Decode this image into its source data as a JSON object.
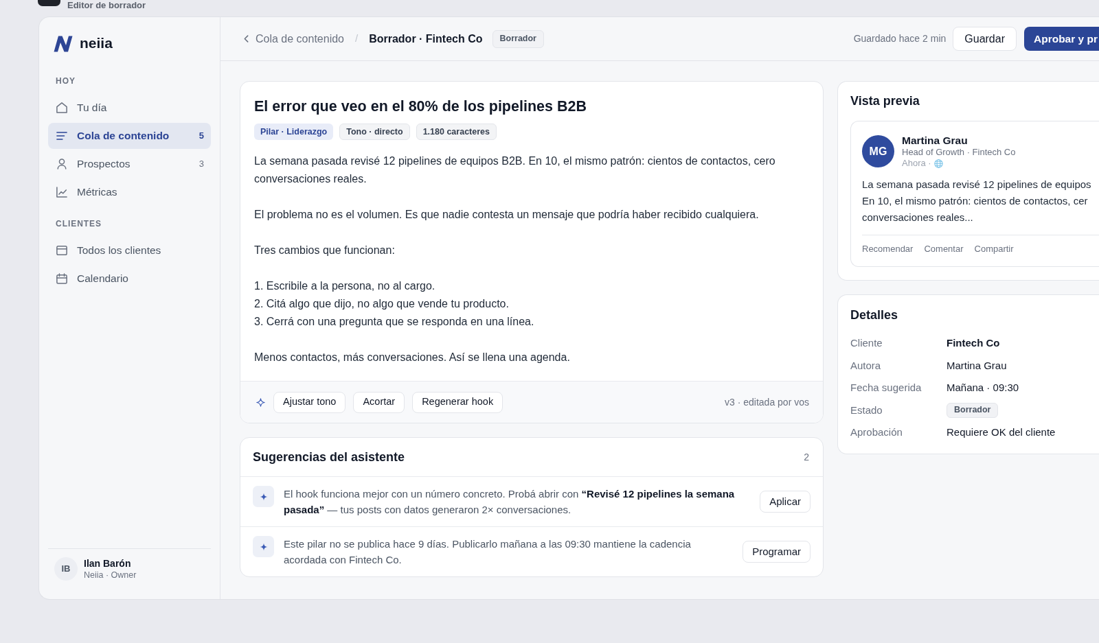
{
  "top_bar": {
    "title": "Editor de borrador"
  },
  "sidebar": {
    "logo": "neiia",
    "sections": [
      {
        "heading": "HOY",
        "items": [
          {
            "label": "Tu día",
            "selected": false
          },
          {
            "label": "Cola de contenido",
            "selected": true,
            "count": "5"
          },
          {
            "label": "Prospectos",
            "selected": false,
            "count": "3"
          },
          {
            "label": "Métricas",
            "selected": false
          }
        ]
      },
      {
        "heading": "CLIENTES",
        "items": [
          {
            "label": "Todos los clientes",
            "selected": false
          },
          {
            "label": "Calendario",
            "selected": false
          }
        ]
      }
    ],
    "user": {
      "initials": "IB",
      "name": "Ilan Barón",
      "role": "Neiia · Owner"
    }
  },
  "header": {
    "back_link": "Cola de contenido",
    "separator": "/",
    "title": "Borrador · Fintech Co",
    "status_badge": "Borrador",
    "saved_note": "Guardado hace 2 min",
    "buttons": [
      {
        "label": "Guardar",
        "kind": "secondary"
      },
      {
        "label": "Aprobar y pr",
        "kind": "primary"
      }
    ]
  },
  "editor": {
    "title": "El error que veo en el 80% de los pipelines B2B",
    "tags": [
      {
        "label": "Pilar · Liderazgo",
        "kind": "pillar"
      },
      {
        "label": "Tono · directo",
        "kind": "neutral"
      },
      {
        "label": "1.180 caracteres",
        "kind": "neutral"
      }
    ],
    "paragraphs": [
      {
        "kind": "text",
        "text": "La semana pasada revisé 12 pipelines de equipos B2B. En 10, el mismo patrón: cientos de contactos, cero conversaciones reales."
      },
      {
        "kind": "text",
        "text": "El problema no es el volumen. Es que nadie contesta un mensaje que podría haber recibido cualquiera."
      },
      {
        "kind": "text",
        "text": "Tres cambios que funcionan:"
      },
      {
        "kind": "list",
        "items": [
          "1. Escribile a la persona, no al cargo.",
          "2. Citá algo que dijo, no algo que vende tu producto.",
          "3. Cerrá con una pregunta que se responda en una línea."
        ]
      },
      {
        "kind": "text",
        "text": "Menos contactos, más conversaciones. Así se llena una agenda."
      }
    ],
    "actions": [
      "Ajustar tono",
      "Acortar",
      "Regenerar hook"
    ],
    "version_note": "v3 · editada por vos"
  },
  "suggestions": {
    "title": "Sugerencias del asistente",
    "count": "2",
    "items": [
      {
        "text": "El hook funciona mejor con un número concreto. Probá abrir con **“Revisé 12 pipelines la semana pasada”** — tus posts con datos generaron 2× conversaciones.",
        "action": "Aplicar"
      },
      {
        "text": "Este pilar no se publica hace 9 días. Publicarlo mañana a las 09:30 mantiene la cadencia acordada con Fintech Co.",
        "action": "Programar"
      }
    ]
  },
  "preview": {
    "title": "Vista previa",
    "post": {
      "initials": "MG",
      "author": "Martina Grau",
      "headline": "Head of Growth · Fintech Co",
      "meta": "Ahora ·",
      "text_lines": [
        "La semana pasada revisé 12 pipelines de equipos",
        "En 10, el mismo patrón: cientos de contactos, cer",
        "conversaciones reales..."
      ],
      "actions": [
        "Recomendar",
        "Comentar",
        "Compartir"
      ]
    }
  },
  "details": {
    "title": "Detalles",
    "rows": [
      {
        "label": "Cliente",
        "value": "Fintech Co",
        "kind": "emphasis"
      },
      {
        "label": "Autora",
        "value": "Martina Grau",
        "kind": "text"
      },
      {
        "label": "Fecha sugerida",
        "value": "Mañana · 09:30",
        "kind": "text"
      },
      {
        "label": "Estado",
        "value": "Borrador",
        "kind": "badge"
      },
      {
        "label": "Aprobación",
        "value": "Requiere OK del cliente",
        "kind": "text"
      }
    ]
  }
}
